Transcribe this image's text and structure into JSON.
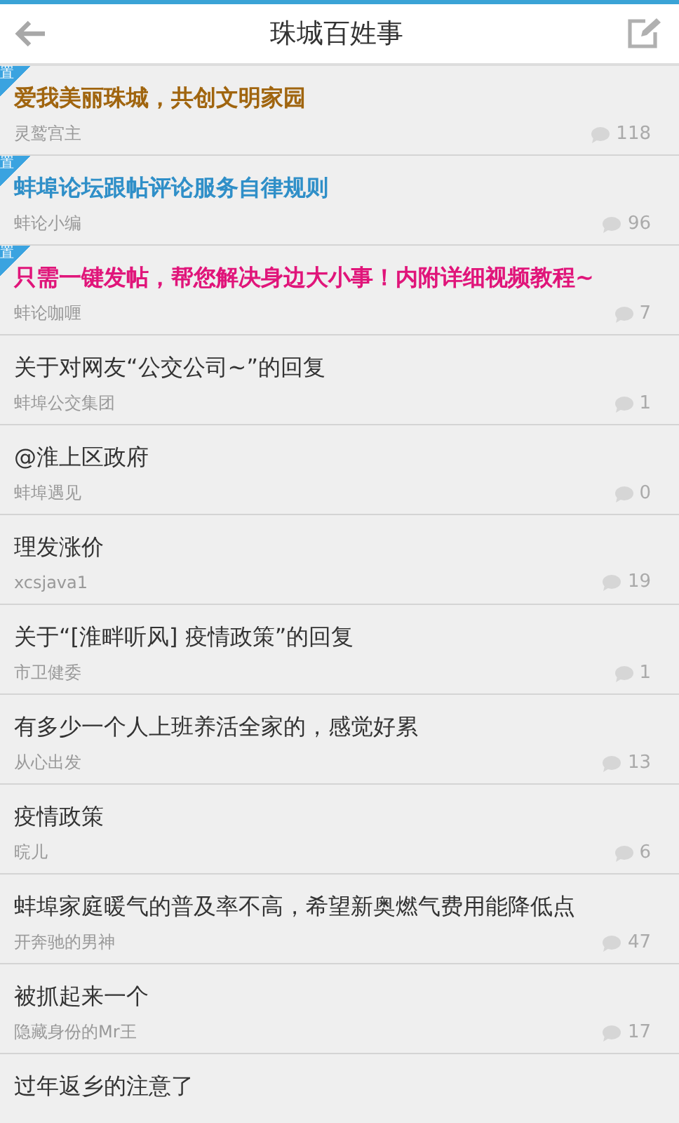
{
  "header": {
    "title": "珠城百姓事"
  },
  "posts": [
    {
      "title": "爱我美丽珠城，共创文明家园",
      "author": "灵鹫宫主",
      "comments": "118",
      "pinned": true,
      "pin_label": "置",
      "color": "#a0650f"
    },
    {
      "title": "蚌埠论坛跟帖评论服务自律规则",
      "author": "蚌论小编",
      "comments": "96",
      "pinned": true,
      "pin_label": "置",
      "color": "#2f8fc8"
    },
    {
      "title": "只需一键发帖，帮您解决身边大小事！内附详细视频教程~",
      "author": "蚌论咖喱",
      "comments": "7",
      "pinned": true,
      "pin_label": "置",
      "color": "#e0157a"
    },
    {
      "title": "关于对网友“公交公司~”的回复",
      "author": "蚌埠公交集团",
      "comments": "1",
      "pinned": false
    },
    {
      "title": "@淮上区政府",
      "author": "蚌埠遇见",
      "comments": "0",
      "pinned": false
    },
    {
      "title": "理发涨价",
      "author": "xcsjava1",
      "comments": "19",
      "pinned": false
    },
    {
      "title": "关于“[淮畔听风] 疫情政策”的回复",
      "author": "市卫健委",
      "comments": "1",
      "pinned": false
    },
    {
      "title": "有多少一个人上班养活全家的，感觉好累",
      "author": "从心出发",
      "comments": "13",
      "pinned": false
    },
    {
      "title": "疫情政策",
      "author": "晥儿",
      "comments": "6",
      "pinned": false
    },
    {
      "title": "蚌埠家庭暖气的普及率不高，希望新奥燃气费用能降低点",
      "author": "开奔驰的男神",
      "comments": "47",
      "pinned": false
    },
    {
      "title": "被抓起来一个",
      "author": "隐藏身份的Mr王",
      "comments": "17",
      "pinned": false
    },
    {
      "title": "过年返乡的注意了",
      "pinned": false
    }
  ]
}
